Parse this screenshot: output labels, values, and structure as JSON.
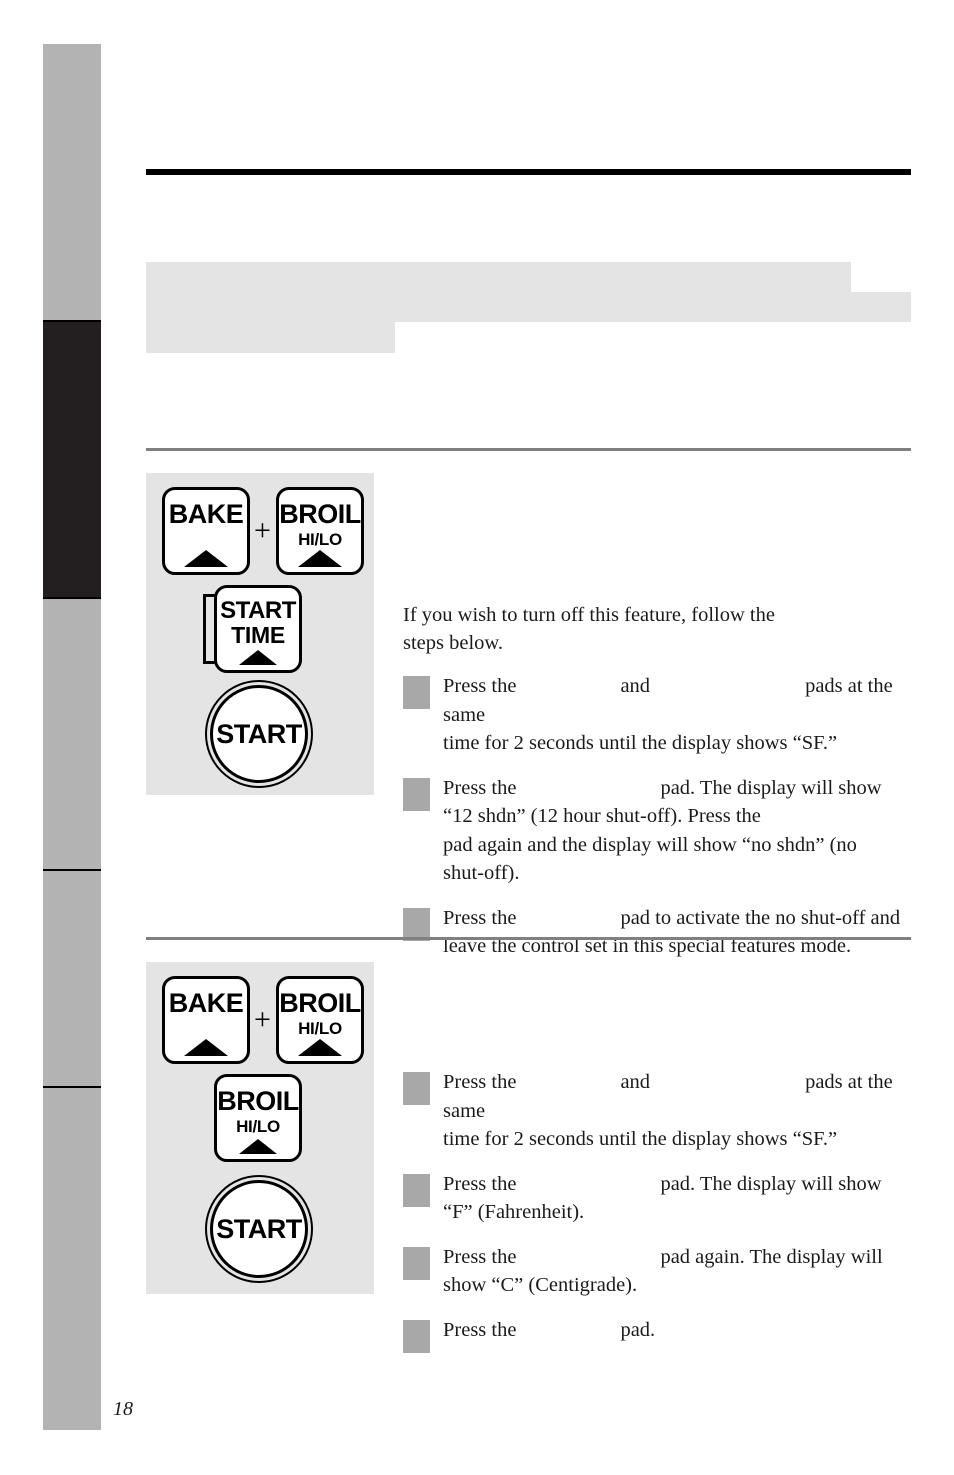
{
  "page": {
    "number": "18"
  },
  "sidebar": {
    "segments": [
      {
        "name": "tab-upper-gray",
        "color": "#b3b3b3"
      },
      {
        "name": "tab-active-dark",
        "color": "#231f20"
      },
      {
        "name": "tab-lower-gray-1",
        "color": "#b3b3b3"
      },
      {
        "name": "tab-lower-gray-2",
        "color": "#b3b3b3"
      },
      {
        "name": "tab-lower-gray-3",
        "color": "#b3b3b3"
      }
    ]
  },
  "redactions": [
    {
      "name": "redacted-heading-row-1"
    },
    {
      "name": "redacted-heading-row-2"
    },
    {
      "name": "redacted-heading-row-3"
    }
  ],
  "section_one": {
    "intro": "If you wish to turn off this feature, follow the steps below.",
    "intro_line_1": "If you wish to turn off this feature, follow the",
    "intro_line_2": "steps below.",
    "steps": [
      {
        "a": "Press the",
        "b": "and",
        "c": "pads at the same",
        "d": "time for 2 seconds until the display shows “SF.”"
      },
      {
        "a": "Press the",
        "b": "pad. The display will show",
        "c": "“12 shdn” (12 hour shut-off). Press the",
        "d": "pad again and the display will show “no shdn” (no",
        "e": "shut-off)."
      },
      {
        "a": "Press the",
        "b": "pad to activate the no shut-off and",
        "c": "leave the control set in this special features mode."
      }
    ],
    "illustration": {
      "pad_bake": {
        "line1": "BAKE"
      },
      "plus": "+",
      "pad_broil": {
        "line1": "BROIL",
        "line2": "HI/LO"
      },
      "pad_start_time": {
        "line1": "START",
        "line2": "TIME"
      },
      "pad_start": {
        "label": "START"
      }
    }
  },
  "section_two": {
    "steps": [
      {
        "a": "Press the",
        "b": "and",
        "c": "pads at the same",
        "d": "time for 2 seconds until the display shows “SF.”"
      },
      {
        "a": "Press the",
        "b": "pad. The display will show",
        "c": "“F” (Fahrenheit)."
      },
      {
        "a": "Press the",
        "b": "pad again. The display will",
        "c": "show “C” (Centigrade)."
      },
      {
        "a": "Press the",
        "b": "pad."
      }
    ],
    "illustration": {
      "pad_bake": {
        "line1": "BAKE"
      },
      "plus": "+",
      "pad_broil_top": {
        "line1": "BROIL",
        "line2": "HI/LO"
      },
      "pad_broil_mid": {
        "line1": "BROIL",
        "line2": "HI/LO"
      },
      "pad_start": {
        "label": "START"
      }
    }
  },
  "colors": {
    "tab_gray": "#b3b3b3",
    "tab_dark": "#231f20",
    "panel_gray": "#e4e4e4",
    "marker_gray": "#a8a8a8",
    "rule_gray": "#808080",
    "rule_black": "#000000"
  }
}
